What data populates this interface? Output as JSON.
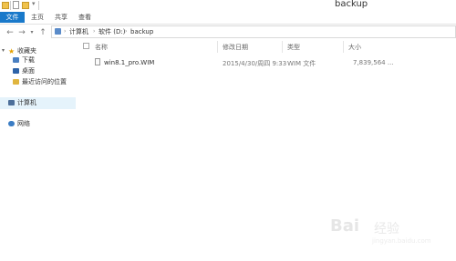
{
  "window": {
    "title": "backup"
  },
  "ribbon": {
    "tabs": [
      "文件",
      "主页",
      "共享",
      "查看"
    ]
  },
  "address": {
    "parts": [
      "计算机",
      "软件 (D:)",
      "backup"
    ]
  },
  "nav": {
    "favorites_label": "收藏夹",
    "favorites": [
      "下载",
      "桌面",
      "最近访问的位置"
    ],
    "computer": "计算机",
    "network": "网络"
  },
  "columns": [
    "名称",
    "修改日期",
    "类型",
    "大小"
  ],
  "files": [
    {
      "name": "win8.1_pro.WIM",
      "modified": "2015/4/30/周四 9:33",
      "type": "WIM 文件",
      "size": "7,839,564 ..."
    }
  ],
  "watermark": {
    "logo": "Bai",
    "text": "经验",
    "url": "jingyan.baidu.com"
  },
  "colors": {
    "file_tab": "#1979ca",
    "selection": "#e5f3fb"
  }
}
